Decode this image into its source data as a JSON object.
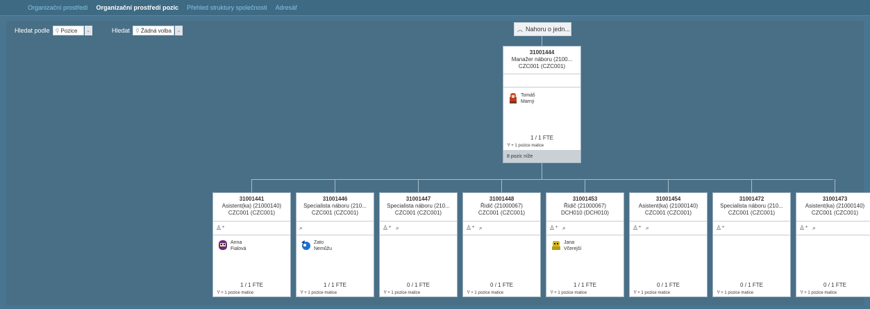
{
  "nav": {
    "tabs": [
      {
        "label": "Organizační prostředí",
        "active": false
      },
      {
        "label": "Organizační prostředí pozic",
        "active": true
      },
      {
        "label": "Přehled struktury společnosti",
        "active": false
      },
      {
        "label": "Adresář",
        "active": false
      }
    ]
  },
  "filters": {
    "search_by_label": "Hledat podle",
    "search_by_value": "Pozice",
    "search_label": "Hledat",
    "search_value": "Žádná volba"
  },
  "up_button": "Nahoru o jedn...",
  "top_card": {
    "id": "31001444",
    "title": "Manažer náboru (2100...",
    "org": "CZC001 (CZC001)",
    "holder_first": "Tomáš",
    "holder_last": "Marný",
    "fte": "1 / 1 FTE",
    "matrix": "+ 1 pozice matice",
    "below": "8 pozic níže"
  },
  "cards": [
    {
      "id": "31001441",
      "title": "Asistent(ka) (21000140)",
      "org": "CZC001 (CZC001)",
      "icons": "add-person",
      "holder_first": "Anna",
      "holder_last": "Fialová",
      "avatar": "purple",
      "fte": "1 / 1 FTE",
      "matrix": "+ 1 pozice matice"
    },
    {
      "id": "31001446",
      "title": "Specialista náboru (210...",
      "org": "CZC001 (CZC001)",
      "icons": "search-person",
      "holder_first": "Zato",
      "holder_last": "Nemůžu",
      "avatar": "blue",
      "fte": "1 / 1 FTE",
      "matrix": "+ 1 pozice matice"
    },
    {
      "id": "31001447",
      "title": "Specialista náboru (210...",
      "org": "CZC001 (CZC001)",
      "icons": "both",
      "holder_first": "",
      "holder_last": "",
      "avatar": "",
      "fte": "0 / 1 FTE",
      "matrix": "+ 1 pozice matice"
    },
    {
      "id": "31001448",
      "title": "Řidič (21000067)",
      "org": "CZC001 (CZC001)",
      "icons": "both",
      "holder_first": "",
      "holder_last": "",
      "avatar": "",
      "fte": "0 / 1 FTE",
      "matrix": "+ 1 pozice matice"
    },
    {
      "id": "31001453",
      "title": "Řidič (21000067)",
      "org": "DCH010 (DCH010)",
      "icons": "both",
      "holder_first": "Jana",
      "holder_last": "Včerejší",
      "avatar": "yellow",
      "fte": "1 / 1 FTE",
      "matrix": "+ 1 pozice matice"
    },
    {
      "id": "31001454",
      "title": "Asistent(ka) (21000140)",
      "org": "CZC001 (CZC001)",
      "icons": "both",
      "holder_first": "",
      "holder_last": "",
      "avatar": "",
      "fte": "0 / 1 FTE",
      "matrix": "+ 1 pozice matice"
    },
    {
      "id": "31001472",
      "title": "Specialista náboru (210...",
      "org": "CZC001 (CZC001)",
      "icons": "add-person",
      "holder_first": "",
      "holder_last": "",
      "avatar": "",
      "fte": "0 / 1 FTE",
      "matrix": "+ 1 pozice matice"
    },
    {
      "id": "31001473",
      "title": "Asistent(ka) (21000140)",
      "org": "CZC001 (CZC001)",
      "icons": "both",
      "holder_first": "",
      "holder_last": "",
      "avatar": "",
      "fte": "0 / 1 FTE",
      "matrix": "+ 1 pozice matice"
    }
  ],
  "colors": {
    "background": "#4a7590",
    "topbar": "#3f6a84",
    "link": "#7fc6e6",
    "card_footer": "#c9d0d6"
  }
}
